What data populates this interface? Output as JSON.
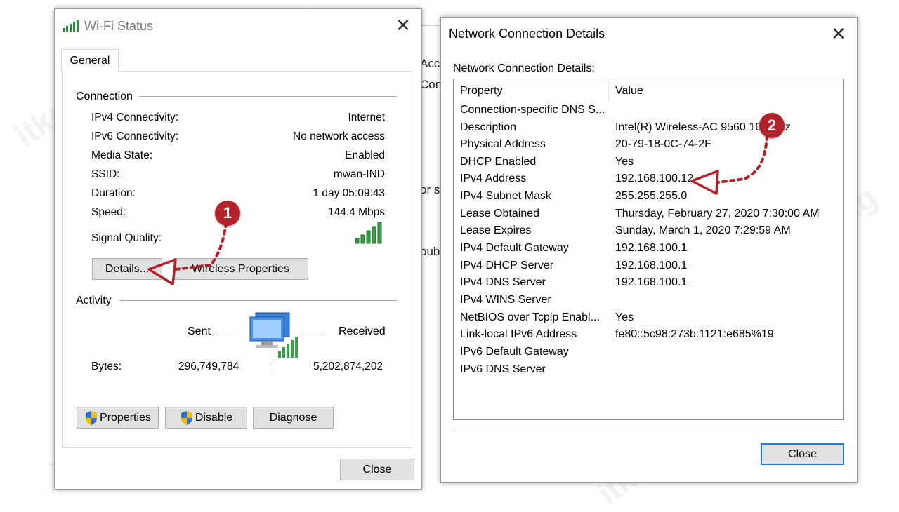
{
  "bg_fragments": [
    "Acc",
    "Con",
    "or s",
    "oub"
  ],
  "wifi_status": {
    "title": "Wi-Fi Status",
    "tab": "General",
    "connection_label": "Connection",
    "rows": [
      {
        "label": "IPv4 Connectivity:",
        "value": "Internet"
      },
      {
        "label": "IPv6 Connectivity:",
        "value": "No network access"
      },
      {
        "label": "Media State:",
        "value": "Enabled"
      },
      {
        "label": "SSID:",
        "value": "mwan-IND"
      },
      {
        "label": "Duration:",
        "value": "1 day 05:09:43"
      },
      {
        "label": "Speed:",
        "value": "144.4 Mbps"
      }
    ],
    "signal_label": "Signal Quality:",
    "details_button": "Details...",
    "wireless_button": "Wireless Properties",
    "activity_label": "Activity",
    "sent_label": "Sent",
    "received_label": "Received",
    "bytes_label": "Bytes:",
    "bytes_sent": "296,749,784",
    "bytes_received": "5,202,874,202",
    "properties_button": "Properties",
    "disable_button": "Disable",
    "diagnose_button": "Diagnose",
    "close_button": "Close"
  },
  "details": {
    "title": "Network Connection Details",
    "subtitle": "Network Connection Details:",
    "col_property": "Property",
    "col_value": "Value",
    "rows": [
      {
        "p": "Connection-specific DNS S...",
        "v": ""
      },
      {
        "p": "Description",
        "v": "Intel(R) Wireless-AC 9560 160MHz"
      },
      {
        "p": "Physical Address",
        "v": "20-79-18-0C-74-2F"
      },
      {
        "p": "DHCP Enabled",
        "v": "Yes"
      },
      {
        "p": "IPv4 Address",
        "v": "192.168.100.12"
      },
      {
        "p": "IPv4 Subnet Mask",
        "v": "255.255.255.0"
      },
      {
        "p": "Lease Obtained",
        "v": "Thursday, February 27, 2020 7:30:00 AM"
      },
      {
        "p": "Lease Expires",
        "v": "Sunday, March 1, 2020 7:29:59 AM"
      },
      {
        "p": "IPv4 Default Gateway",
        "v": "192.168.100.1"
      },
      {
        "p": "IPv4 DHCP Server",
        "v": "192.168.100.1"
      },
      {
        "p": "IPv4 DNS Server",
        "v": "192.168.100.1"
      },
      {
        "p": "IPv4 WINS Server",
        "v": ""
      },
      {
        "p": "NetBIOS over Tcpip Enabl...",
        "v": "Yes"
      },
      {
        "p": "Link-local IPv6 Address",
        "v": "fe80::5c98:273b:1121:e685%19"
      },
      {
        "p": "IPv6 Default Gateway",
        "v": ""
      },
      {
        "p": "IPv6 DNS Server",
        "v": ""
      }
    ],
    "close_button": "Close"
  },
  "annotations": {
    "marker1": "1",
    "marker2": "2",
    "color": "#b3222a"
  },
  "watermark": "itkoding"
}
